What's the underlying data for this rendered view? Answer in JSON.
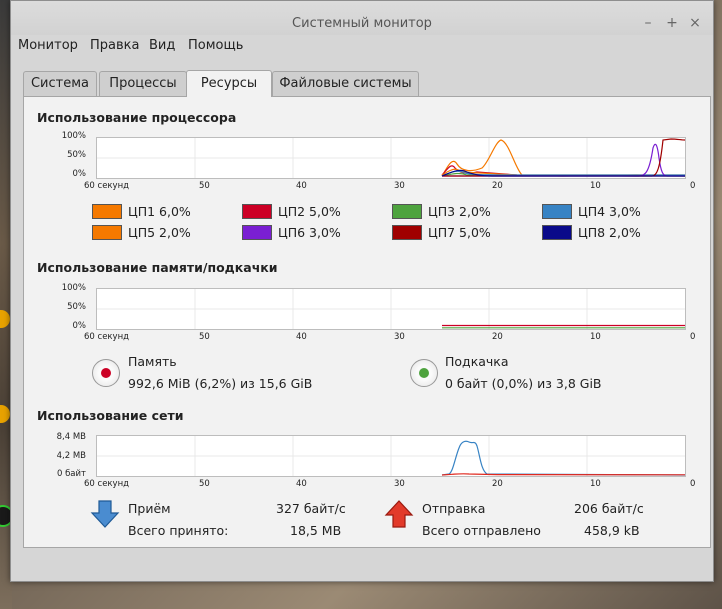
{
  "window": {
    "title": "Системный монитор",
    "controls": [
      "–",
      "+",
      "×"
    ]
  },
  "menu": [
    "Монитор",
    "Правка",
    "Вид",
    "Помощь"
  ],
  "tabs": [
    {
      "label": "Система",
      "active": false
    },
    {
      "label": "Процессы",
      "active": false
    },
    {
      "label": "Ресурсы",
      "active": true
    },
    {
      "label": "Файловые системы",
      "active": false
    }
  ],
  "cpu": {
    "title": "Использование процессора",
    "y_labels": [
      "100%",
      "50%",
      "0%"
    ],
    "x_labels": [
      "60 секунд",
      "50",
      "40",
      "30",
      "20",
      "10",
      "0"
    ],
    "legend": [
      {
        "label": "ЦП1",
        "value": "6,0%",
        "color": "#f57900"
      },
      {
        "label": "ЦП2",
        "value": "5,0%",
        "color": "#cc0025"
      },
      {
        "label": "ЦП3",
        "value": "2,0%",
        "color": "#4ea33e"
      },
      {
        "label": "ЦП4",
        "value": "3,0%",
        "color": "#3783c4"
      },
      {
        "label": "ЦП5",
        "value": "2,0%",
        "color": "#f57900"
      },
      {
        "label": "ЦП6",
        "value": "3,0%",
        "color": "#7a1fd2"
      },
      {
        "label": "ЦП7",
        "value": "5,0%",
        "color": "#a00000"
      },
      {
        "label": "ЦП8",
        "value": "2,0%",
        "color": "#0a0a8a"
      }
    ]
  },
  "memory": {
    "title": "Использование памяти/подкачки",
    "y_labels": [
      "100%",
      "50%",
      "0%"
    ],
    "x_labels": [
      "60 секунд",
      "50",
      "40",
      "30",
      "20",
      "10",
      "0"
    ],
    "mem_label": "Память",
    "mem_value": "992,6 MiB (6,2%) из 15,6 GiB",
    "mem_color": "#cc0025",
    "swap_label": "Подкачка",
    "swap_value": "0 байт (0,0%) из 3,8 GiB",
    "swap_color": "#4ea33e"
  },
  "network": {
    "title": "Использование сети",
    "y_labels": [
      "8,4 MB",
      "4,2 MB",
      "0 байт"
    ],
    "x_labels": [
      "60 секунд",
      "50",
      "40",
      "30",
      "20",
      "10",
      "0"
    ],
    "recv_label": "Приём",
    "recv_rate": "327 байт/с",
    "recv_total_label": "Всего принято:",
    "recv_total": "18,5 MB",
    "send_label": "Отправка",
    "send_rate": "206 байт/с",
    "send_total_label": "Всего отправлено",
    "send_total": "458,9 kB",
    "recv_color": "#3783c4",
    "send_color": "#e0281e"
  }
}
